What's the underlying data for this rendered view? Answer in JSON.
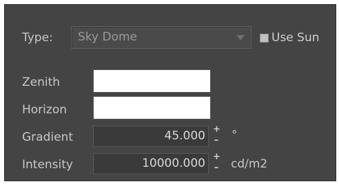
{
  "type_row": {
    "label": "Type:",
    "selected": "Sky Dome",
    "use_sun_label": "Use Sun",
    "use_sun_checked": true
  },
  "zenith": {
    "label": "Zenith",
    "color": "#ffffff"
  },
  "horizon": {
    "label": "Horizon",
    "color": "#ffffff"
  },
  "gradient": {
    "label": "Gradient",
    "value": "45.000",
    "unit": "°"
  },
  "intensity": {
    "label": "Intensity",
    "value": "10000.000",
    "unit": "cd/m2"
  },
  "spinner": {
    "up": "+",
    "down": "–"
  }
}
